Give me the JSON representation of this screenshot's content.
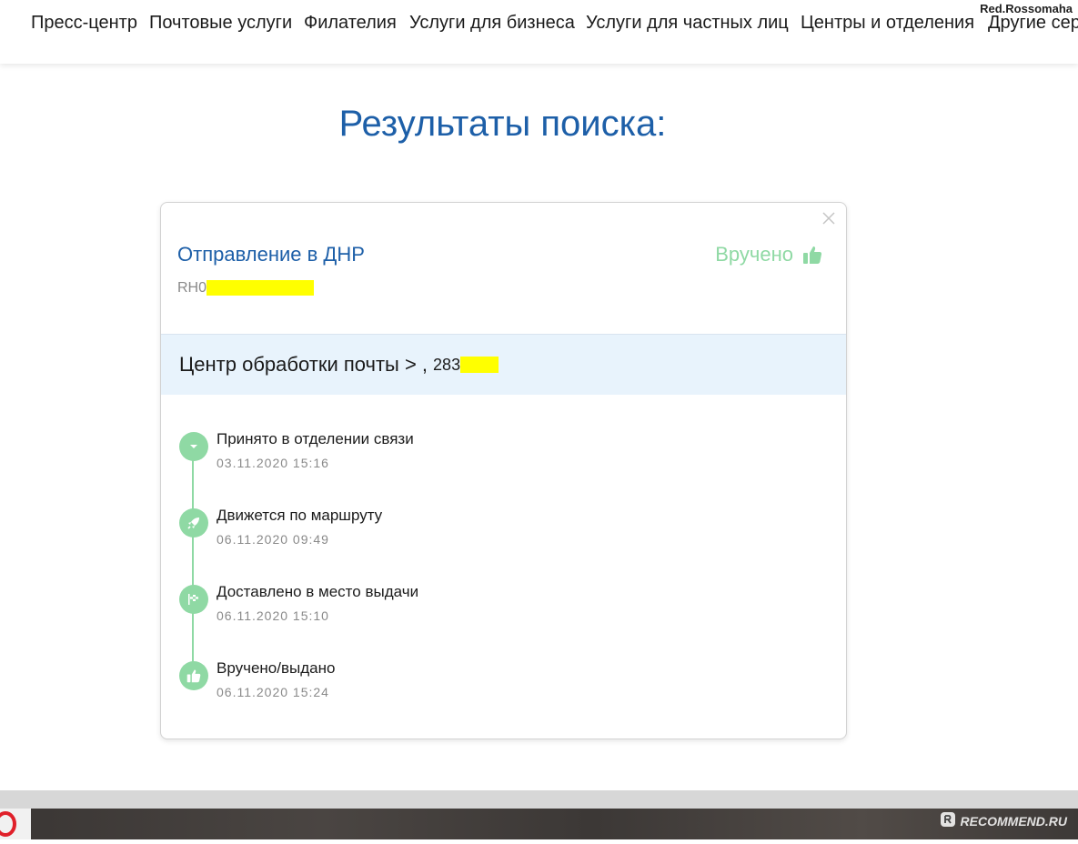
{
  "nav": {
    "items": [
      "Пресс-центр",
      "Почтовые услуги",
      "Филателия",
      "Услуги для бизнеса",
      "Услуги для частных лиц",
      "Центры и отделения",
      "Другие сер"
    ]
  },
  "watermark_user": "Red.Rossomaha",
  "page_title": "Результаты поиска:",
  "shipment": {
    "title": "Отправление в ДНР",
    "track_prefix": "RH0",
    "status": "Вручено",
    "office_label": "Центр обработки почты > ,",
    "office_index_prefix": "283"
  },
  "events": [
    {
      "name": "Принято в отделении связи",
      "date": "03.11.2020 15:16",
      "icon": "chevron-down-icon"
    },
    {
      "name": "Движется по маршруту",
      "date": "06.11.2020 09:49",
      "icon": "rocket-icon"
    },
    {
      "name": "Доставлено в место выдачи",
      "date": "06.11.2020 15:10",
      "icon": "flag-icon"
    },
    {
      "name": "Вручено/выдано",
      "date": "06.11.2020 15:24",
      "icon": "thumbs-up-icon"
    }
  ],
  "site_watermark": "RECOMMEND.RU",
  "colors": {
    "accent_blue": "#1d5fa8",
    "status_green": "#8fd9a4",
    "band_blue": "#e8f3fc",
    "redaction_yellow": "#ffff00"
  }
}
